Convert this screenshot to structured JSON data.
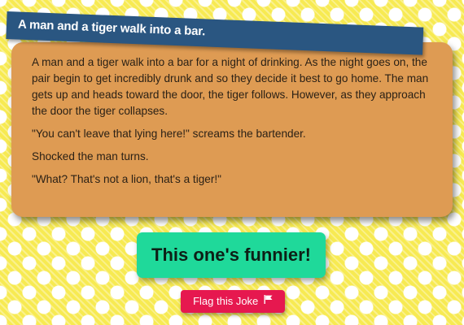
{
  "joke": {
    "title": "A man and a tiger walk into a bar.",
    "paragraphs": [
      "A man and a tiger walk into a bar for a night of drinking. As the night goes on, the pair begin to get incredibly drunk and so they decide it best to go home. The man gets up and heads toward the door, the tiger follows. However, as they approach the door the tiger collapses.",
      "\"You can't leave that lying here!\" screams the bartender.",
      "Shocked the man turns.",
      "\"What? That's not a lion, that's a tiger!\""
    ]
  },
  "actions": {
    "funnier_label": "This one's funnier!",
    "flag_label": "Flag this Joke",
    "flag_icon": "flag-icon"
  },
  "colors": {
    "background": "#f7ea52",
    "title_banner": "#2a5681",
    "card": "#de9b53",
    "funnier_button": "#1fd99a",
    "flag_button": "#e6184f"
  }
}
